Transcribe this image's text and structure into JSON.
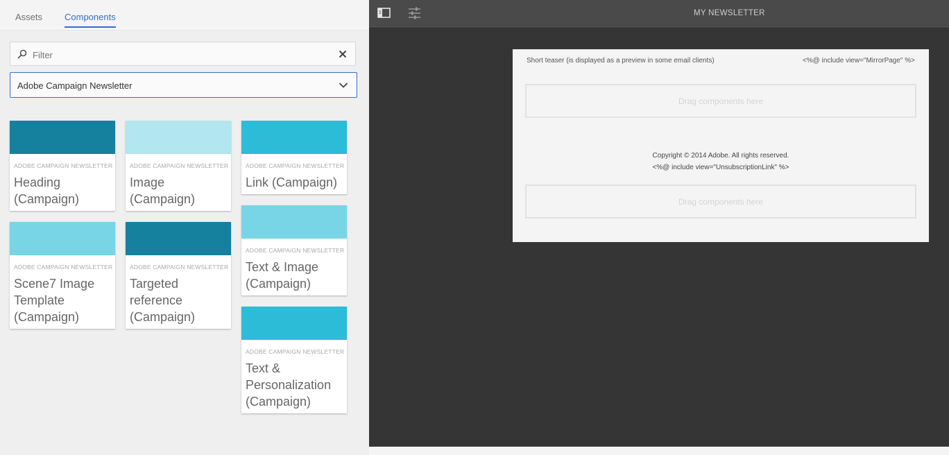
{
  "sidebar": {
    "tabs": [
      {
        "label": "Assets",
        "active": false
      },
      {
        "label": "Components",
        "active": true
      }
    ],
    "filter": {
      "placeholder": "Filter",
      "value": ""
    },
    "group_select": {
      "value": "Adobe Campaign Newsletter"
    },
    "components": [
      {
        "group": "ADOBE CAMPAIGN NEWSLETTER",
        "title": "Heading (Campaign)",
        "color": "#16819e"
      },
      {
        "group": "ADOBE CAMPAIGN NEWSLETTER",
        "title": "Image (Campaign)",
        "color": "#b2e6f0"
      },
      {
        "group": "ADOBE CAMPAIGN NEWSLETTER",
        "title": "Link (Campaign)",
        "color": "#2cbcd8"
      },
      {
        "group": "ADOBE CAMPAIGN NEWSLETTER",
        "title": "Scene7 Image Template (Campaign)",
        "color": "#78d5e6"
      },
      {
        "group": "ADOBE CAMPAIGN NEWSLETTER",
        "title": "Targeted reference (Campaign)",
        "color": "#16819e"
      },
      {
        "group": "ADOBE CAMPAIGN NEWSLETTER",
        "title": "Text & Image (Campaign)",
        "color": "#78d5e6"
      },
      {
        "group": "ADOBE CAMPAIGN NEWSLETTER",
        "title": "Text & Personalization (Campaign)",
        "color": "#2cbcd8"
      }
    ]
  },
  "toolbar": {
    "title": "MY NEWSLETTER",
    "icons": [
      "side-panel-icon",
      "page-properties-icon"
    ]
  },
  "page": {
    "teaser": "Short teaser (is displayed as a preview in some email clients)",
    "mirror": "<%@ include view=\"MirrorPage\" %>",
    "dropzone_label": "Drag components here",
    "copyright": "Copyright © 2014 Adobe. All rights reserved.",
    "unsubscribe": "<%@ include view=\"UnsubscriptionLink\" %>"
  },
  "colors": {
    "accent": "#326ec8",
    "editor_bg": "#353535",
    "toolbar_bg": "#4a4a4a"
  }
}
